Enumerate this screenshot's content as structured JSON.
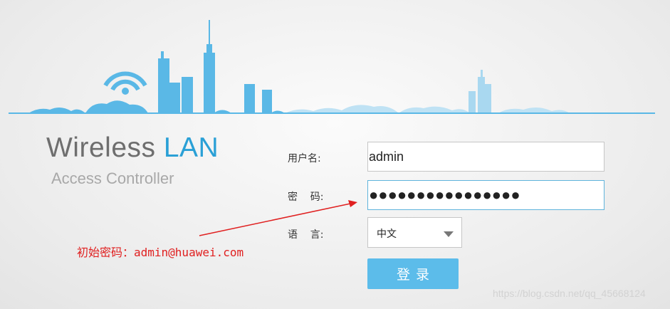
{
  "brand": {
    "title_part1": "Wireless",
    "title_part2": "LAN",
    "subtitle": "Access Controller"
  },
  "form": {
    "username_label": "用户名:",
    "username_value": "admin",
    "password_label": "密    码:",
    "password_value": "●●●●●●●●●●●●●●●●",
    "language_label": "语    言:",
    "language_value": "中文",
    "login_button": "登录"
  },
  "annotation": {
    "text": "初始密码：admin@huawei.com",
    "color": "#e02020"
  },
  "watermark": "https://blog.csdn.net/qq_45668124",
  "colors": {
    "brand_blue": "#2aa0d6",
    "skyline_blue": "#5ab8e6",
    "button_blue": "#5cbcea"
  },
  "icons": {
    "wifi": "wifi-icon",
    "dropdown": "chevron-down-icon"
  }
}
